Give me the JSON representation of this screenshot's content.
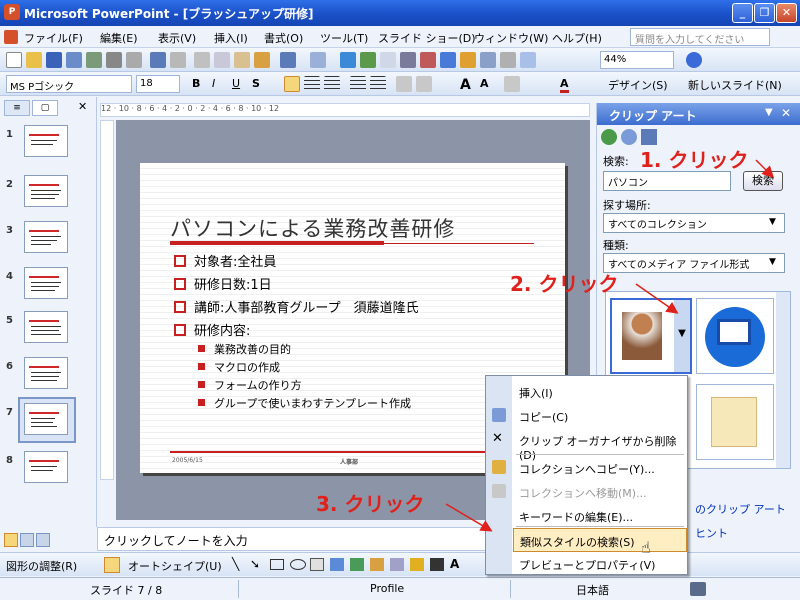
{
  "window": {
    "title": "Microsoft PowerPoint - [ブラッシュアップ研修]",
    "icon": "powerpoint-icon"
  },
  "menubar": {
    "items": [
      "ファイル(F)",
      "編集(E)",
      "表示(V)",
      "挿入(I)",
      "書式(O)",
      "ツール(T)",
      "スライド ショー(D)",
      "ウィンドウ(W)",
      "ヘルプ(H)"
    ],
    "help_placeholder": "質問を入力してください"
  },
  "toolbar": {
    "zoom": "44%",
    "font_name": "MS Pゴシック",
    "font_size": "18",
    "design_label": "デザイン(S)",
    "new_slide_label": "新しいスライド(N)",
    "format_buttons": [
      "B",
      "I",
      "U",
      "S"
    ]
  },
  "left_panel": {
    "tab_outline": "アウトライン",
    "tab_slides": "スライド",
    "slides": [
      "1",
      "2",
      "3",
      "4",
      "5",
      "6",
      "7",
      "8"
    ],
    "selected": "7"
  },
  "ruler": {
    "text": "12 · 10 · 8 · 6 · 4 · 2 · 0 · 2 · 4 · 6 · 8 · 10 · 12"
  },
  "slide": {
    "title": "パソコンによる業務改善研修",
    "bullets": [
      "対象者:全社員",
      "研修日数:1日",
      "講師:人事部教育グループ　須藤道隆氏",
      "研修内容:"
    ],
    "sub_bullets": [
      "業務改善の目的",
      "マクロの作成",
      "フォームの作り方",
      "グループで使いまわすテンプレート作成"
    ],
    "footer_date": "2005/6/15",
    "footer_center": "人事部"
  },
  "notes": {
    "placeholder": "クリックしてノートを入力"
  },
  "drawbar": {
    "draw_label": "図形の調整(R)",
    "autoshape_label": "オートシェイプ(U)"
  },
  "statusbar": {
    "slide": "スライド 7 / 8",
    "design": "Profile",
    "language": "日本語"
  },
  "taskpane": {
    "title": "クリップ アート",
    "search_label": "検索:",
    "search_value": "パソコン",
    "search_button": "検索",
    "location_label": "探す場所:",
    "location_value": "すべてのコレクション",
    "type_label": "種類:",
    "type_value": "すべてのメディア ファイル形式",
    "link1": "のクリップ アート",
    "link2": "ヒント"
  },
  "context_menu": {
    "items": [
      {
        "label": "挿入(I)",
        "icon": "insert-icon",
        "disabled": false
      },
      {
        "label": "コピー(C)",
        "icon": "copy-icon",
        "disabled": false
      },
      {
        "label": "クリップ オーガナイザから削除(D)",
        "icon": "delete-icon",
        "disabled": false
      },
      {
        "label": "コレクションへコピー(Y)...",
        "icon": "copy-to-collection-icon",
        "disabled": false
      },
      {
        "label": "コレクションへ移動(M)...",
        "icon": "move-to-collection-icon",
        "disabled": true
      },
      {
        "label": "キーワードの編集(E)...",
        "icon": "",
        "disabled": false
      },
      {
        "label": "類似スタイルの検索(S)",
        "icon": "",
        "disabled": false,
        "highlighted": true
      },
      {
        "label": "プレビューとプロパティ(V)",
        "icon": "",
        "disabled": false
      }
    ]
  },
  "annotations": [
    "1. クリック",
    "2. クリック",
    "3. クリック"
  ],
  "colors": {
    "titlebar": "#1a50c8",
    "accent_red": "#c82020",
    "annotation": "#e0201a",
    "highlight": "#ffeec2"
  }
}
